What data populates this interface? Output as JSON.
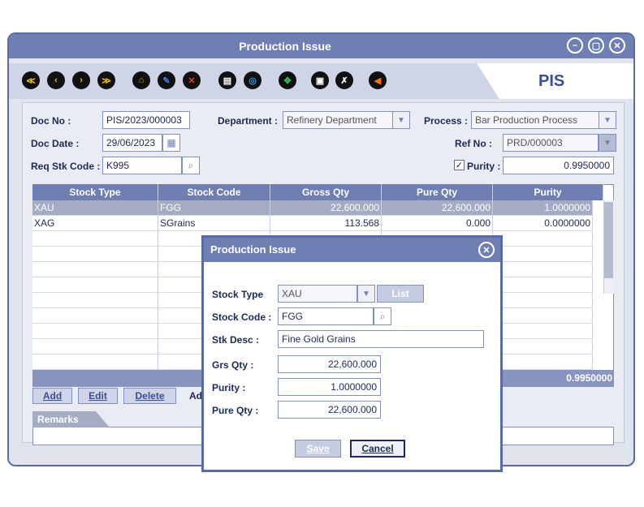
{
  "window": {
    "title": "Production Issue",
    "module_code": "PIS"
  },
  "toolbar": {
    "buttons": [
      {
        "name": "first-record-icon",
        "glyph": "≪",
        "color": "#f2c100"
      },
      {
        "name": "previous-record-icon",
        "glyph": "‹",
        "color": "#f2c100"
      },
      {
        "name": "next-record-icon",
        "glyph": "›",
        "color": "#f2c100"
      },
      {
        "name": "last-record-icon",
        "glyph": "≫",
        "color": "#f2c100"
      },
      {
        "name": "new-record-icon",
        "glyph": "⌂",
        "color": "#f2a000"
      },
      {
        "name": "edit-record-icon",
        "glyph": "✎",
        "color": "#3a7be0"
      },
      {
        "name": "delete-record-icon",
        "glyph": "✕",
        "color": "#e04020"
      },
      {
        "name": "print-icon",
        "glyph": "▤",
        "color": "#ffffff"
      },
      {
        "name": "search-icon",
        "glyph": "◎",
        "color": "#2aa0e0"
      },
      {
        "name": "refresh-icon",
        "glyph": "✥",
        "color": "#2ec050"
      },
      {
        "name": "save-icon",
        "glyph": "▣",
        "color": "#ffffff"
      },
      {
        "name": "cancel-icon",
        "glyph": "✗",
        "color": "#ffffff"
      },
      {
        "name": "exit-icon",
        "glyph": "◀",
        "color": "#f07010"
      }
    ]
  },
  "form": {
    "doc_no": {
      "label": "Doc No :",
      "value": "PIS/2023/000003"
    },
    "department": {
      "label": "Department :",
      "value": "Refinery Department"
    },
    "process": {
      "label": "Process :",
      "value": "Bar Production Process"
    },
    "doc_date": {
      "label": "Doc Date :",
      "value": "29/06/2023"
    },
    "ref_no": {
      "label": "Ref No :",
      "value": "PRD/000003"
    },
    "req_stk_code": {
      "label": "Req Stk Code :",
      "value": "K995"
    },
    "purity": {
      "label": "Purity :",
      "value": "0.9950000",
      "checked": true
    }
  },
  "grid": {
    "columns": [
      "Stock Type",
      "Stock Code",
      "Gross Qty",
      "Pure Qty",
      "Purity"
    ],
    "rows": [
      [
        "XAU",
        "FGG",
        "22,600.000",
        "22,600.000",
        "1.0000000"
      ],
      [
        "XAG",
        "SGrains",
        "113.568",
        "0.000",
        "0.0000000"
      ]
    ],
    "footer_purity": "0.9950000"
  },
  "actions": {
    "add": "Add",
    "edit": "Edit",
    "delete": "Delete",
    "partial": "Ad"
  },
  "remarks": {
    "label": "Remarks"
  },
  "modal": {
    "title": "Production Issue",
    "stock_type": {
      "label": "Stock Type",
      "value": "XAU"
    },
    "list_button": "List",
    "stock_code": {
      "label": "Stock Code :",
      "value": "FGG"
    },
    "stk_desc": {
      "label": "Stk Desc :",
      "value": "Fine Gold Grains"
    },
    "grs_qty": {
      "label": "Grs Qty :",
      "value": "22,600.000"
    },
    "purity": {
      "label": "Purity :",
      "value": "1.0000000"
    },
    "pure_qty": {
      "label": "Pure Qty :",
      "value": "22,600.000"
    },
    "save_button": "Save",
    "cancel_button": "Cancel"
  }
}
